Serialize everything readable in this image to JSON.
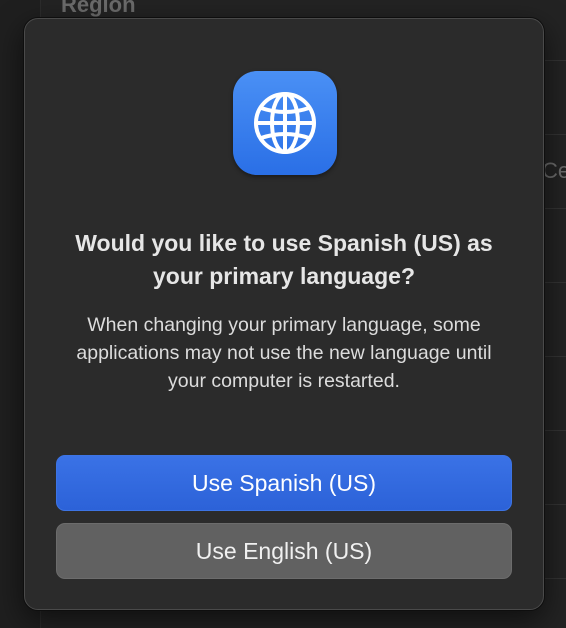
{
  "background": {
    "region_label": "Region",
    "partial_label": "Ce"
  },
  "dialog": {
    "icon": "globe-icon",
    "title": "Would you like to use Spanish (US) as your primary language?",
    "message": "When changing your primary language, some applications may not use the new language until your computer is restarted.",
    "primary_button": "Use Spanish (US)",
    "secondary_button": "Use English (US)"
  },
  "colors": {
    "accent": "#2c62d8",
    "icon_blue": "#3a80f0",
    "dialog_bg": "#2b2b2b",
    "secondary_button": "#616161"
  }
}
